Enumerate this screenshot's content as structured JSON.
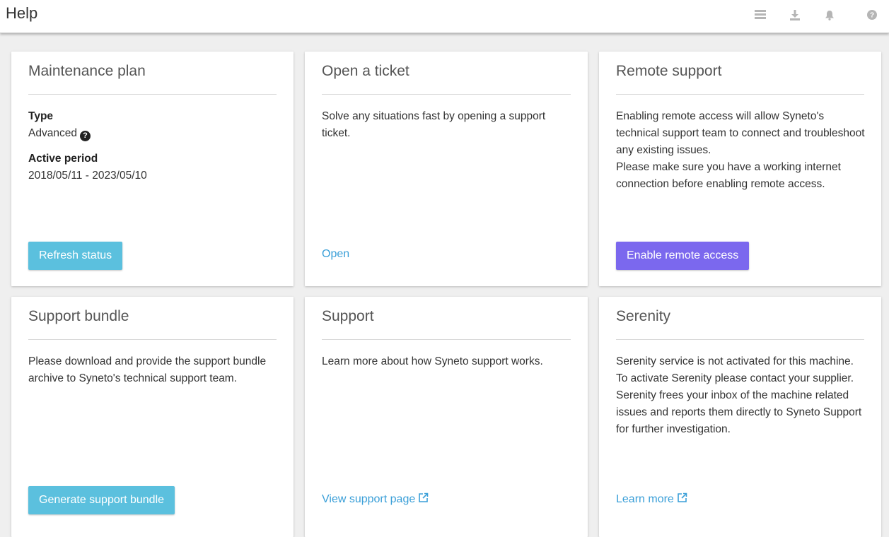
{
  "header": {
    "title": "Help",
    "icons": [
      "list-icon",
      "download-icon",
      "bell-icon",
      "question-circle-icon"
    ],
    "icon_color": "#b5b5b5"
  },
  "cards": {
    "maintenance": {
      "title": "Maintenance plan",
      "type_label": "Type",
      "type_value": "Advanced",
      "period_label": "Active period",
      "period_value": "2018/05/11 - 2023/05/10",
      "button_label": "Refresh status"
    },
    "ticket": {
      "title": "Open a ticket",
      "description": "Solve any situations fast by opening a support ticket.",
      "link_label": "Open"
    },
    "remote": {
      "title": "Remote support",
      "description_1": "Enabling remote access will allow Syneto's technical support team to connect and troubleshoot any existing issues.",
      "description_2": "Please make sure you have a working internet connection before enabling remote access.",
      "button_label": "Enable remote access"
    },
    "bundle": {
      "title": "Support bundle",
      "description": "Please download and provide the support bundle archive to Syneto's technical support team.",
      "button_label": "Generate support bundle"
    },
    "support": {
      "title": "Support",
      "description": "Learn more about how Syneto support works.",
      "link_label": "View support page"
    },
    "serenity": {
      "title": "Serenity",
      "description_1": "Serenity service is not activated for this machine. To activate Serenity please contact your supplier.",
      "description_2": "Serenity frees your inbox of the machine related issues and reports them directly to Syneto Support for further investigation.",
      "link_label": "Learn more"
    }
  },
  "colors": {
    "info_button": "#5bc0de",
    "purple_button": "#7b68ee",
    "link": "#3a9fd8"
  }
}
